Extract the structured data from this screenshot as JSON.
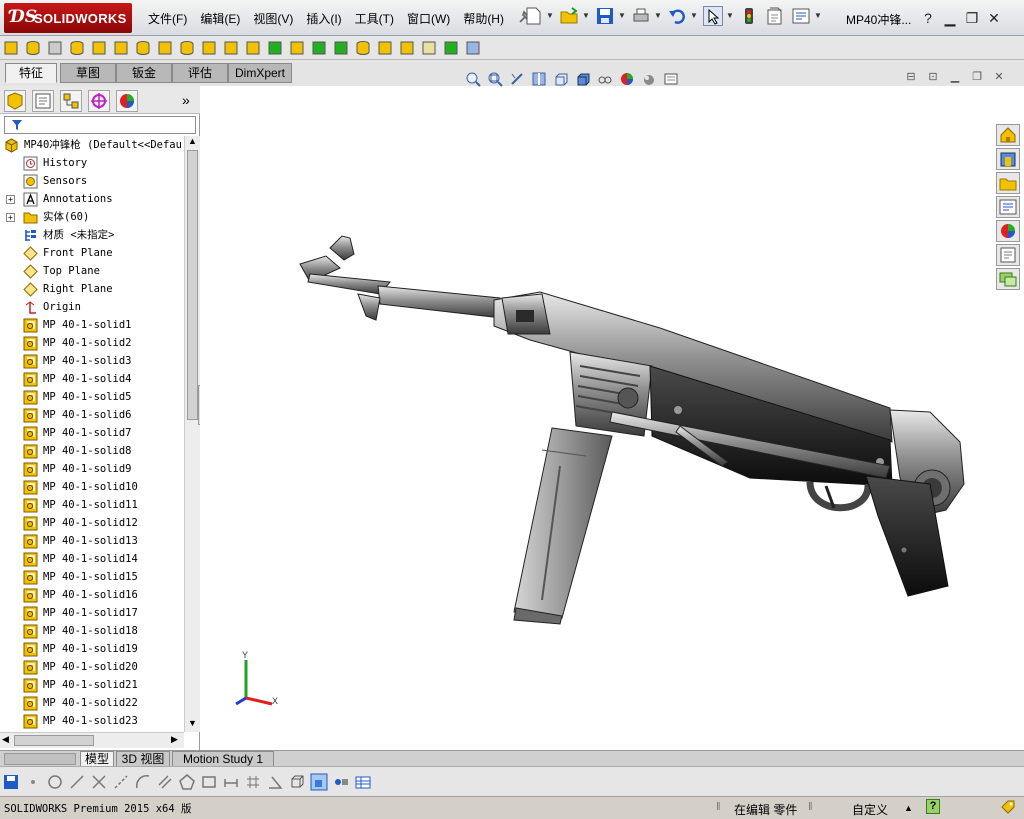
{
  "app": {
    "logo_ds": "ƊS",
    "logo_name": "SOLIDWORKS",
    "doc_title": "MP40冲锋...",
    "help_label": "?"
  },
  "menu": [
    "文件(F)",
    "编辑(E)",
    "视图(V)",
    "插入(I)",
    "工具(T)",
    "窗口(W)",
    "帮助(H)"
  ],
  "command_tabs": [
    "特征",
    "草图",
    "钣金",
    "评估",
    "DimXpert"
  ],
  "feature_tree": {
    "root": "MP40冲锋枪  (Default<<Defau",
    "items": [
      {
        "label": "History",
        "icon": "history-icon"
      },
      {
        "label": "Sensors",
        "icon": "sensors-icon"
      },
      {
        "label": "Annotations",
        "icon": "annotations-icon",
        "expandable": true
      },
      {
        "label": "实体(60)",
        "icon": "solid-bodies-folder-icon",
        "expandable": true
      },
      {
        "label": "材质 <未指定>",
        "icon": "material-icon"
      },
      {
        "label": "Front Plane",
        "icon": "plane-icon"
      },
      {
        "label": "Top Plane",
        "icon": "plane-icon"
      },
      {
        "label": "Right Plane",
        "icon": "plane-icon"
      },
      {
        "label": "Origin",
        "icon": "origin-icon"
      },
      {
        "label": "MP 40-1-solid1",
        "icon": "imported-feature-icon"
      },
      {
        "label": "MP 40-1-solid2",
        "icon": "imported-feature-icon"
      },
      {
        "label": "MP 40-1-solid3",
        "icon": "imported-feature-icon"
      },
      {
        "label": "MP 40-1-solid4",
        "icon": "imported-feature-icon"
      },
      {
        "label": "MP 40-1-solid5",
        "icon": "imported-feature-icon"
      },
      {
        "label": "MP 40-1-solid6",
        "icon": "imported-feature-icon"
      },
      {
        "label": "MP 40-1-solid7",
        "icon": "imported-feature-icon"
      },
      {
        "label": "MP 40-1-solid8",
        "icon": "imported-feature-icon"
      },
      {
        "label": "MP 40-1-solid9",
        "icon": "imported-feature-icon"
      },
      {
        "label": "MP 40-1-solid10",
        "icon": "imported-feature-icon"
      },
      {
        "label": "MP 40-1-solid11",
        "icon": "imported-feature-icon"
      },
      {
        "label": "MP 40-1-solid12",
        "icon": "imported-feature-icon"
      },
      {
        "label": "MP 40-1-solid13",
        "icon": "imported-feature-icon"
      },
      {
        "label": "MP 40-1-solid14",
        "icon": "imported-feature-icon"
      },
      {
        "label": "MP 40-1-solid15",
        "icon": "imported-feature-icon"
      },
      {
        "label": "MP 40-1-solid16",
        "icon": "imported-feature-icon"
      },
      {
        "label": "MP 40-1-solid17",
        "icon": "imported-feature-icon"
      },
      {
        "label": "MP 40-1-solid18",
        "icon": "imported-feature-icon"
      },
      {
        "label": "MP 40-1-solid19",
        "icon": "imported-feature-icon"
      },
      {
        "label": "MP 40-1-solid20",
        "icon": "imported-feature-icon"
      },
      {
        "label": "MP 40-1-solid21",
        "icon": "imported-feature-icon"
      },
      {
        "label": "MP 40-1-solid22",
        "icon": "imported-feature-icon"
      },
      {
        "label": "MP 40-1-solid23",
        "icon": "imported-feature-icon"
      }
    ]
  },
  "triad": {
    "x": "X",
    "y": "Y"
  },
  "bottom_tabs": [
    "模型",
    "3D 视图",
    "Motion Study 1"
  ],
  "status": {
    "version": "SOLIDWORKS Premium 2015 x64 版",
    "mode": "在编辑 零件",
    "units": "自定义",
    "help_glyph": "?"
  },
  "colors": {
    "brand_red": "#b30d0d",
    "accent_blue": "#1e5bc6",
    "gun_metal": "#3a3a3a",
    "icon_yellow": "#f2c200"
  }
}
